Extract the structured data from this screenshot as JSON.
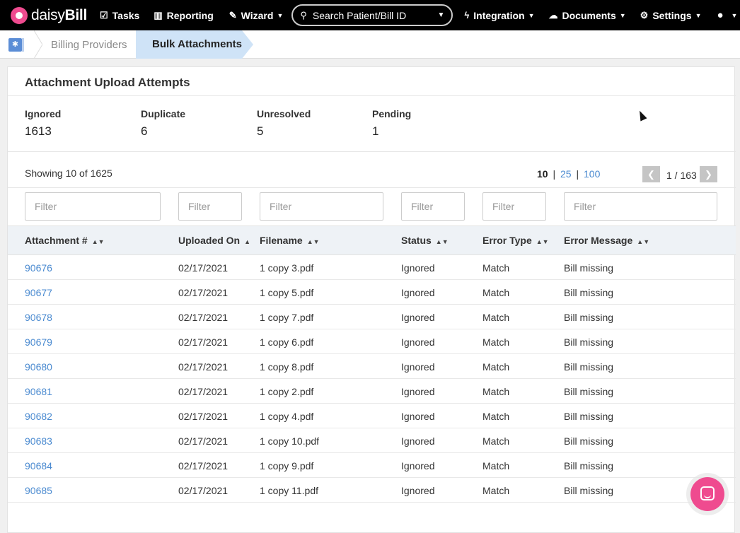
{
  "brand": {
    "name_prefix": "daisy",
    "name_suffix": "Bill"
  },
  "nav": {
    "tasks": "Tasks",
    "reporting": "Reporting",
    "wizard": "Wizard",
    "search_placeholder": "Search Patient/Bill ID",
    "integration": "Integration",
    "documents": "Documents",
    "settings": "Settings"
  },
  "breadcrumb": {
    "parent": "Billing Providers",
    "current": "Bulk Attachments"
  },
  "card": {
    "title": "Attachment Upload Attempts"
  },
  "stats": [
    {
      "label": "Ignored",
      "value": "1613"
    },
    {
      "label": "Duplicate",
      "value": "6"
    },
    {
      "label": "Unresolved",
      "value": "5"
    },
    {
      "label": "Pending",
      "value": "1"
    }
  ],
  "table_meta": {
    "showing": "Showing 10 of 1625",
    "page_sizes": [
      "10",
      "25",
      "100"
    ],
    "pager": "1 / 163",
    "filter_placeholder": "Filter"
  },
  "columns": [
    "Attachment #",
    "Uploaded On",
    "Filename",
    "Status",
    "Error Type",
    "Error Message"
  ],
  "rows": [
    [
      "90676",
      "02/17/2021",
      "1 copy 3.pdf",
      "Ignored",
      "Match",
      "Bill missing"
    ],
    [
      "90677",
      "02/17/2021",
      "1 copy 5.pdf",
      "Ignored",
      "Match",
      "Bill missing"
    ],
    [
      "90678",
      "02/17/2021",
      "1 copy 7.pdf",
      "Ignored",
      "Match",
      "Bill missing"
    ],
    [
      "90679",
      "02/17/2021",
      "1 copy 6.pdf",
      "Ignored",
      "Match",
      "Bill missing"
    ],
    [
      "90680",
      "02/17/2021",
      "1 copy 8.pdf",
      "Ignored",
      "Match",
      "Bill missing"
    ],
    [
      "90681",
      "02/17/2021",
      "1 copy 2.pdf",
      "Ignored",
      "Match",
      "Bill missing"
    ],
    [
      "90682",
      "02/17/2021",
      "1 copy 4.pdf",
      "Ignored",
      "Match",
      "Bill missing"
    ],
    [
      "90683",
      "02/17/2021",
      "1 copy 10.pdf",
      "Ignored",
      "Match",
      "Bill missing"
    ],
    [
      "90684",
      "02/17/2021",
      "1 copy 9.pdf",
      "Ignored",
      "Match",
      "Bill missing"
    ],
    [
      "90685",
      "02/17/2021",
      "1 copy 11.pdf",
      "Ignored",
      "Match",
      "Bill missing"
    ]
  ],
  "colors": {
    "brand_pink": "#ef4b8f",
    "link_blue": "#4a8ad0",
    "crumb_active_bg": "#cfe3f7"
  },
  "icons": [
    "tasks-icon",
    "reporting-icon",
    "wizard-icon",
    "search-icon",
    "integration-icon",
    "documents-icon",
    "settings-icon",
    "user-icon",
    "chat-icon"
  ]
}
